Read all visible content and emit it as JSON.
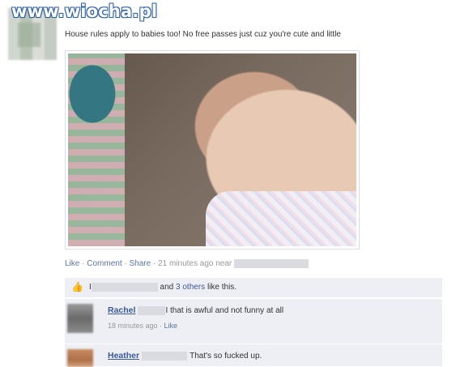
{
  "watermark": "www.wiocha.pl",
  "post": {
    "text": "House rules apply to babies too! No free passes just cuz you're cute and little"
  },
  "feedback": {
    "like": "Like",
    "sep1": " · ",
    "comment": "Comment",
    "sep2": " · ",
    "share": "Share",
    "time": " · 21 minutes ago near "
  },
  "likes": {
    "prefix": "I",
    "mid": " and ",
    "others": "3 others",
    "suffix": " like this."
  },
  "comments": [
    {
      "name": "Rachel",
      "text": "I that is awful and not funny at all",
      "time": "18 minutes ago",
      "sep": " · ",
      "like": "Like"
    },
    {
      "name": "Heather",
      "text": "That's so fucked up."
    }
  ],
  "icons": {
    "like": "thumbs-up-icon"
  }
}
